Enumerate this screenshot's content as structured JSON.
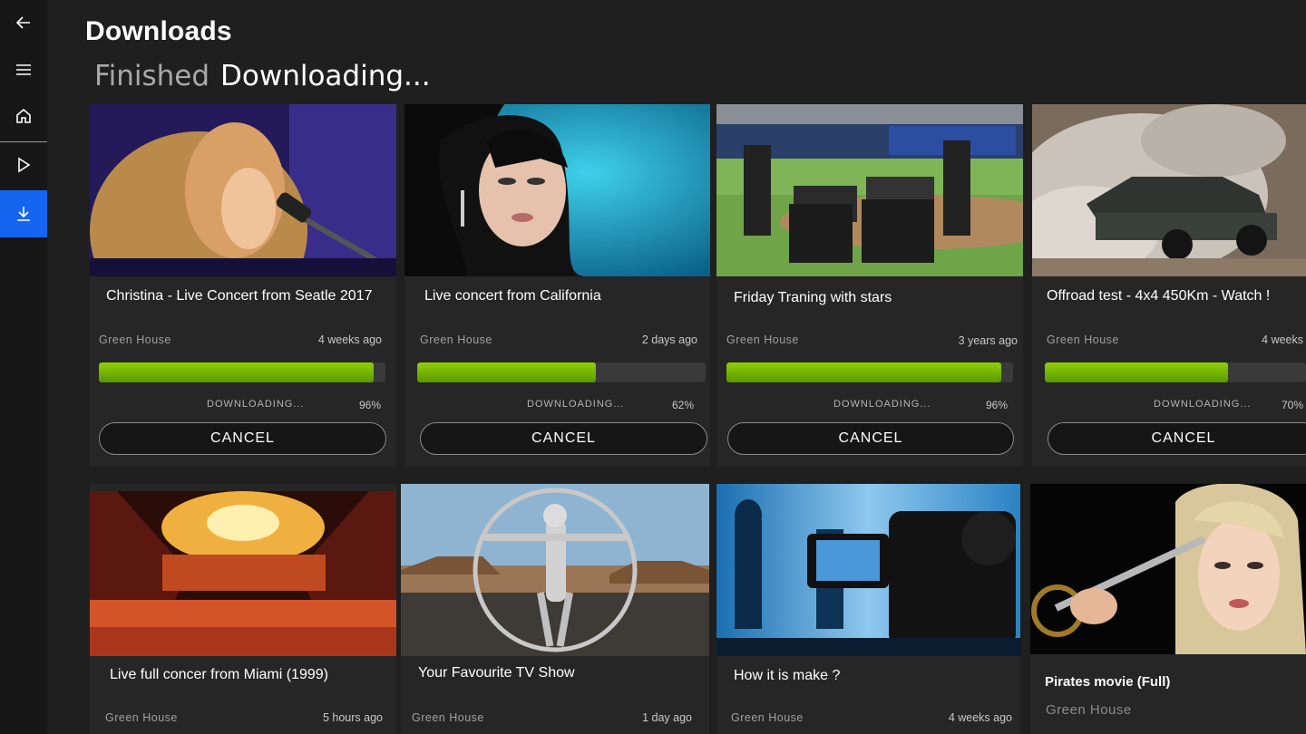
{
  "header": {
    "title": "Downloads",
    "tabs": [
      {
        "label": "Finished"
      },
      {
        "label": "Downloading..."
      }
    ]
  },
  "sidebar": {
    "items": [
      {
        "icon": "back-arrow-icon"
      },
      {
        "icon": "hamburger-menu-icon"
      },
      {
        "icon": "home-icon"
      },
      {
        "icon": "play-icon"
      },
      {
        "icon": "download-icon",
        "active": true
      }
    ],
    "accent": "#1565f0"
  },
  "downloads": [
    {
      "title": "Christina - Live Concert from Seatle 2017",
      "channel": "Green House",
      "time": "4 weeks ago",
      "status": "DOWNLOADING...",
      "progress": 96,
      "progress_label": "96%",
      "action": "CANCEL"
    },
    {
      "title": "Live concert from California",
      "channel": "Green House",
      "time": "2 days ago",
      "status": "DOWNLOADING...",
      "progress": 62,
      "progress_label": "62%",
      "action": "CANCEL"
    },
    {
      "title": "Friday Traning with stars",
      "channel": "Green House",
      "time": "3 years ago",
      "status": "DOWNLOADING...",
      "progress": 96,
      "progress_label": "96%",
      "action": "CANCEL"
    },
    {
      "title": "Offroad test - 4x4 450Km - Watch !",
      "channel": "Green House",
      "time": "4 weeks",
      "status": "DOWNLOADING...",
      "progress": 70,
      "progress_label": "70%",
      "action": "CANCEL"
    },
    {
      "title": "Live full concer from Miami (1999)",
      "channel": "Green House",
      "time": "5 hours ago"
    },
    {
      "title": "Your Favourite TV Show",
      "channel": "Green House",
      "time": "1 day ago"
    },
    {
      "title": "How it is make ?",
      "channel": "Green House",
      "time": "4 weeks ago"
    },
    {
      "title": "Pirates movie  (Full)",
      "channel": "Green House"
    }
  ],
  "colors": {
    "progress": "#7ab800",
    "background": "#1f1f1f",
    "card": "#262626"
  }
}
